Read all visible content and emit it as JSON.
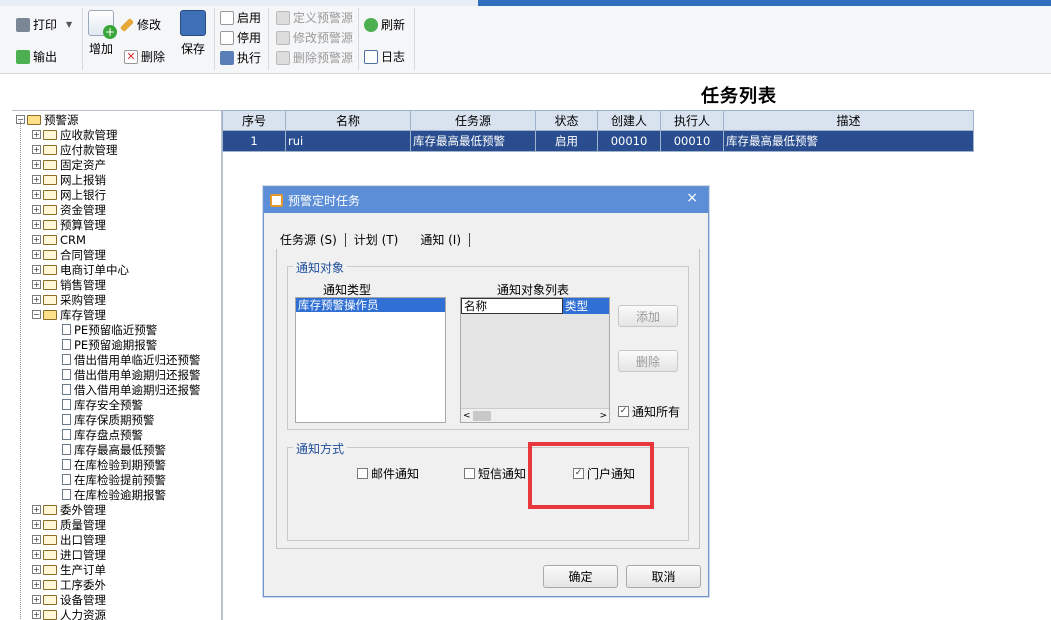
{
  "toolbar": {
    "print": "打印",
    "export": "输出",
    "add": "增加",
    "edit": "修改",
    "delete": "删除",
    "save": "保存",
    "enable": "启用",
    "disable": "停用",
    "execute": "执行",
    "define_alert": "定义预警源",
    "modify_alert": "修改预警源",
    "delete_alert": "删除预警源",
    "refresh": "刷新",
    "log": "日志"
  },
  "page_title": "任务列表",
  "tree": {
    "root": "预警源",
    "items": [
      "应收款管理",
      "应付款管理",
      "固定资产",
      "网上报销",
      "网上银行",
      "资金管理",
      "预算管理",
      "CRM",
      "合同管理",
      "电商订单中心",
      "销售管理",
      "采购管理"
    ],
    "open_item": "库存管理",
    "children": [
      "PE预留临近预警",
      "PE预留逾期报警",
      "借出借用单临近归还预警",
      "借出借用单逾期归还报警",
      "借入借用单逾期归还报警",
      "库存安全预警",
      "库存保质期预警",
      "库存盘点预警",
      "库存最高最低预警",
      "在库检验到期预警",
      "在库检验提前预警",
      "在库检验逾期报警"
    ],
    "items_after": [
      "委外管理",
      "质量管理",
      "出口管理",
      "进口管理",
      "生产订单",
      "工序委外",
      "设备管理",
      "人力资源"
    ]
  },
  "grid": {
    "headers": [
      "序号",
      "名称",
      "任务源",
      "状态",
      "创建人",
      "执行人",
      "描述"
    ],
    "rows": [
      [
        "1",
        "rui",
        "库存最高最低预警",
        "启用",
        "00010",
        "00010",
        "库存最高最低预警"
      ]
    ]
  },
  "dialog": {
    "title": "预警定时任务",
    "close": "×",
    "tabs": [
      "任务源 (S)",
      "计划 (T)",
      "通知 (I)"
    ],
    "notify_target_group": "通知对象",
    "notify_type_label": "通知类型",
    "notify_type_selected": "库存预警操作员",
    "notify_list_label": "通知对象列表",
    "list_col_name": "名称",
    "list_col_type": "类型",
    "add_button": "添加",
    "delete_button": "删除",
    "notify_all": "通知所有",
    "notify_method_group": "通知方式",
    "email_notify": "邮件通知",
    "sms_notify": "短信通知",
    "portal_notify": "门户通知",
    "ok": "确定",
    "cancel": "取消"
  },
  "colors": {
    "accent": "#2f6fbd",
    "selection": "#3070d5",
    "highlight_box": "#e8383d"
  }
}
